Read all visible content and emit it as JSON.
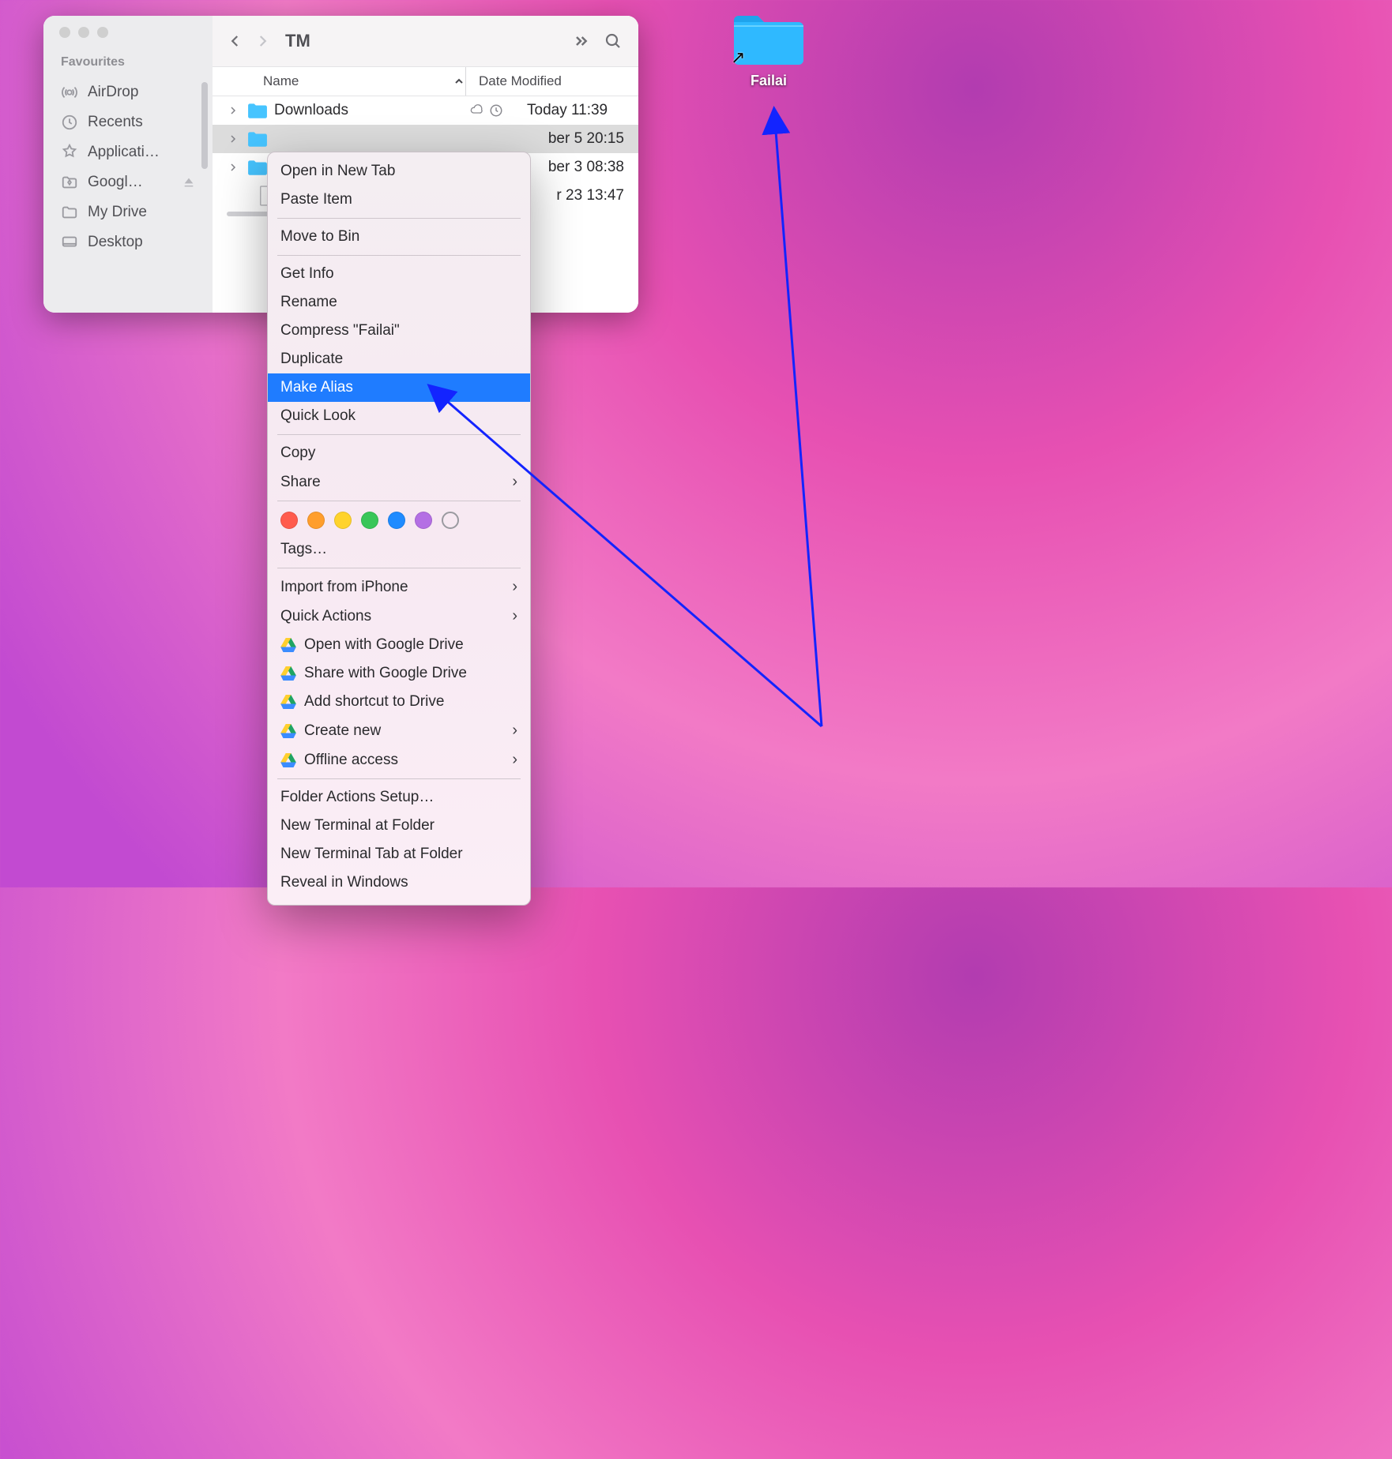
{
  "window": {
    "title": "TM",
    "sidebar": {
      "section_label": "Favourites",
      "items": [
        {
          "label": "AirDrop"
        },
        {
          "label": "Recents"
        },
        {
          "label": "Applicati…"
        },
        {
          "label": "Googl…"
        },
        {
          "label": "My Drive"
        },
        {
          "label": "Desktop"
        }
      ]
    },
    "columns": {
      "name": "Name",
      "date": "Date Modified"
    },
    "rows": [
      {
        "name": "Downloads",
        "date": "Today 11:39",
        "cloud": true,
        "time_icon": true
      },
      {
        "name": "",
        "date": "ber 5 20:15",
        "selected": true
      },
      {
        "name": "",
        "date": "ber 3 08:38"
      }
    ],
    "extra_row_date": "r 23 13:47"
  },
  "context_menu": {
    "group1": [
      "Open in New Tab",
      "Paste Item"
    ],
    "move_to_bin": "Move to Bin",
    "group2": [
      "Get Info",
      "Rename",
      "Compress \"Failai\"",
      "Duplicate",
      "Make Alias",
      "Quick Look"
    ],
    "highlighted_index": 4,
    "group3": [
      "Copy",
      "Share"
    ],
    "tags_label": "Tags…",
    "tag_colors": [
      "#ff5b4d",
      "#ff9e2c",
      "#ffd32c",
      "#39c659",
      "#1f8bff",
      "#b46fe4",
      "#ffffff00"
    ],
    "group4": [
      {
        "label": "Import from iPhone",
        "submenu": true
      },
      {
        "label": "Quick Actions",
        "submenu": true
      },
      {
        "label": "Open with Google Drive",
        "gdrive": true
      },
      {
        "label": "Share with Google Drive",
        "gdrive": true
      },
      {
        "label": "Add shortcut to Drive",
        "gdrive": true
      },
      {
        "label": "Create new",
        "gdrive": true,
        "submenu": true
      },
      {
        "label": "Offline access",
        "gdrive": true,
        "submenu": true
      }
    ],
    "group5": [
      "Folder Actions Setup…",
      "New Terminal at Folder",
      "New Terminal Tab at Folder",
      "Reveal in Windows"
    ]
  },
  "desktop_alias": {
    "label": "Failai"
  }
}
